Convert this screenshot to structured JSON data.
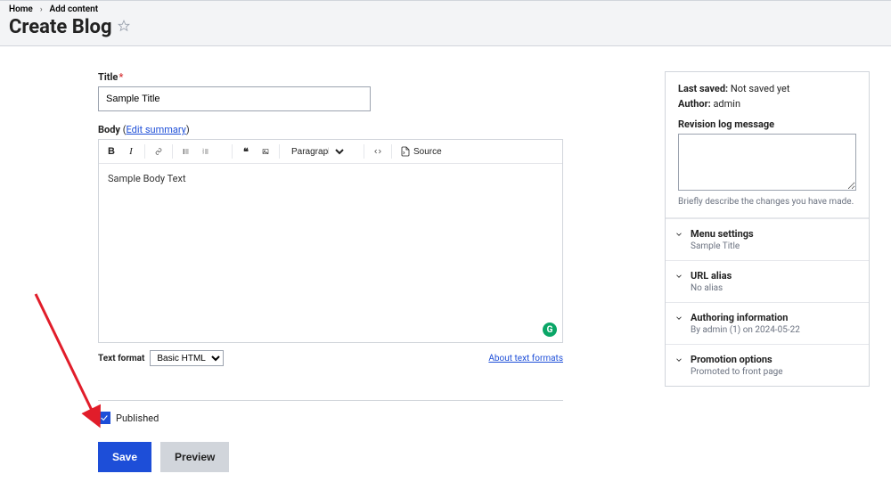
{
  "breadcrumb": {
    "home": "Home",
    "add_content": "Add content"
  },
  "page_title": "Create Blog",
  "form": {
    "title_label": "Title",
    "title_value": "Sample Title",
    "body_label": "Body",
    "edit_summary_link": "Edit summary",
    "body_value": "Sample Body Text",
    "paragraph_option": "Paragraph",
    "source_label": "Source",
    "text_format_label": "Text format",
    "text_format_value": "Basic HTML",
    "about_formats_link": "About text formats",
    "published_label": "Published",
    "published_checked": true
  },
  "actions": {
    "save": "Save",
    "preview": "Preview"
  },
  "sidebar": {
    "last_saved_label": "Last saved:",
    "last_saved_value": "Not saved yet",
    "author_label": "Author:",
    "author_value": "admin",
    "revision_label": "Revision log message",
    "revision_help": "Briefly describe the changes you have made.",
    "accordions": [
      {
        "title": "Menu settings",
        "sub": "Sample Title"
      },
      {
        "title": "URL alias",
        "sub": "No alias"
      },
      {
        "title": "Authoring information",
        "sub": "By admin (1) on 2024-05-22"
      },
      {
        "title": "Promotion options",
        "sub": "Promoted to front page"
      }
    ]
  }
}
